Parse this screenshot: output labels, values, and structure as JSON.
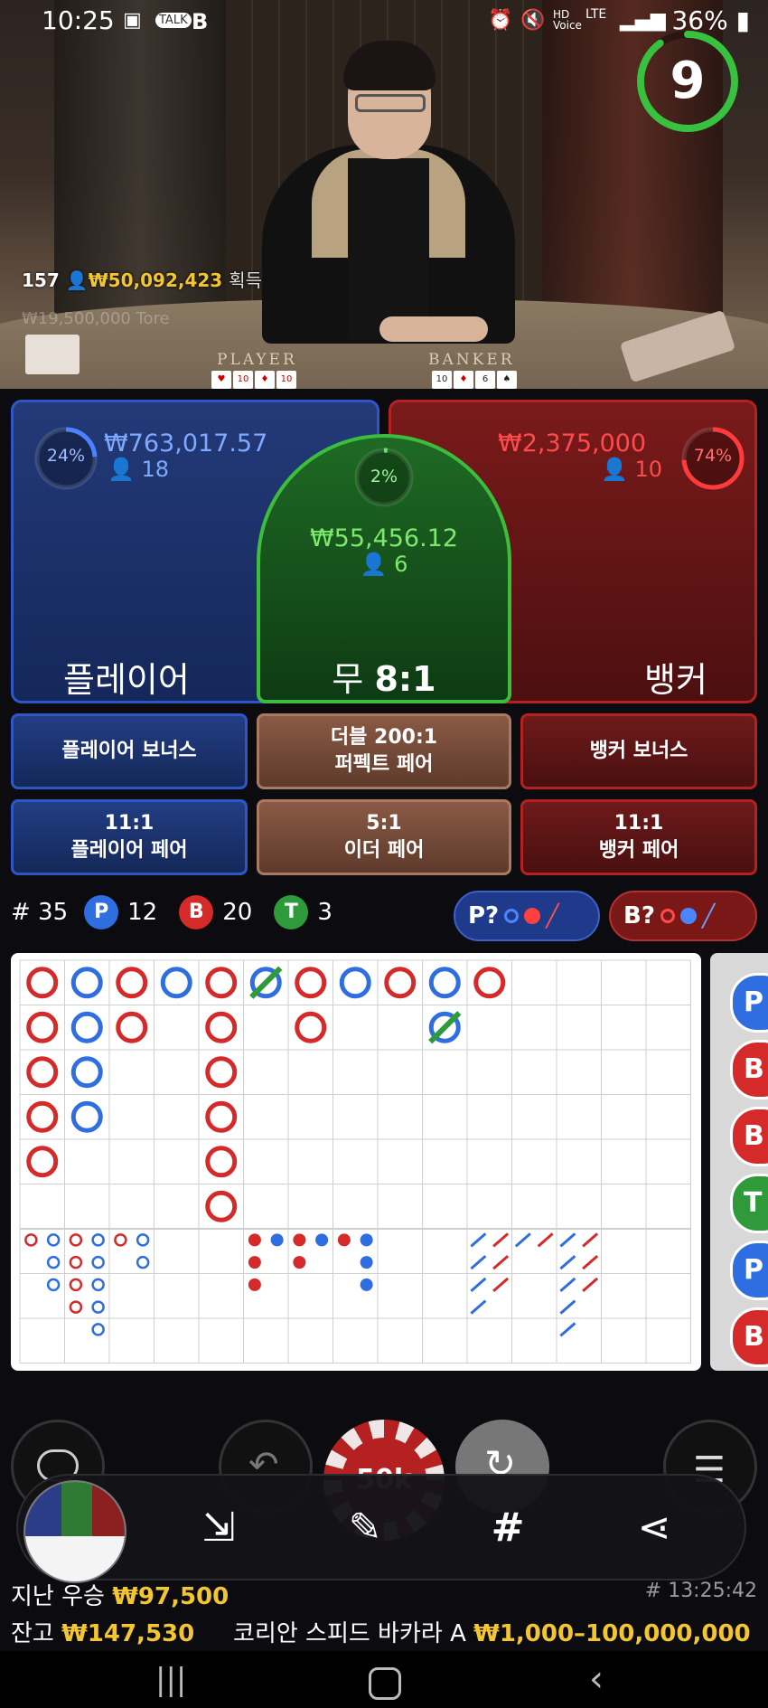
{
  "status_bar": {
    "time": "10:25",
    "battery": "36%"
  },
  "timer": {
    "value": "9",
    "progress": 0.9
  },
  "winners": {
    "count": "157",
    "amount": "₩50,092,423",
    "suffix": "획득"
  },
  "faded_text": "₩19,500,000  Tore",
  "table": {
    "player_label": "PLAYER",
    "banker_label": "BANKER"
  },
  "player": {
    "percent": "24%",
    "amount": "₩763,017.57",
    "players": "18",
    "title": "플레이어",
    "fill": 0.24
  },
  "tie": {
    "percent": "2%",
    "amount": "₩55,456.12",
    "players": "6",
    "title_a": "무",
    "title_b": "8:1",
    "fill": 0.02
  },
  "banker": {
    "percent": "74%",
    "amount": "₩2,375,000",
    "players": "10",
    "title": "뱅커",
    "fill": 0.74
  },
  "side_bets": {
    "player_bonus": "플레이어 보너스",
    "perfect_pair_l1": "더블 200:1",
    "perfect_pair_l2": "퍼펙트 페어",
    "banker_bonus": "뱅커 보너스",
    "player_pair_l1": "11:1",
    "player_pair_l2": "플레이어 페어",
    "either_pair_l1": "5:1",
    "either_pair_l2": "이더 페어",
    "banker_pair_l1": "11:1",
    "banker_pair_l2": "뱅커 페어"
  },
  "stats": {
    "round": "# 35",
    "p_label": "P",
    "p": "12",
    "b_label": "B",
    "b": "20",
    "t_label": "T",
    "t": "3"
  },
  "ask": {
    "player": "P?",
    "banker": "B?"
  },
  "side_road": [
    "P",
    "B",
    "B",
    "T",
    "P",
    "B"
  ],
  "chip": {
    "value": "50k"
  },
  "bottom": {
    "last_win_label": "지난 우승",
    "last_win": "₩97,500",
    "time": "# 13:25:42",
    "balance_label": "잔고",
    "balance": "₩147,530",
    "table_name": "코리안 스피드 바카라 A",
    "limits": "₩1,000–100,000,000"
  },
  "colors": {
    "player": "#2f56c7",
    "banker": "#d42a2a",
    "tie": "#2f9a3a",
    "gold": "#f2c531"
  }
}
